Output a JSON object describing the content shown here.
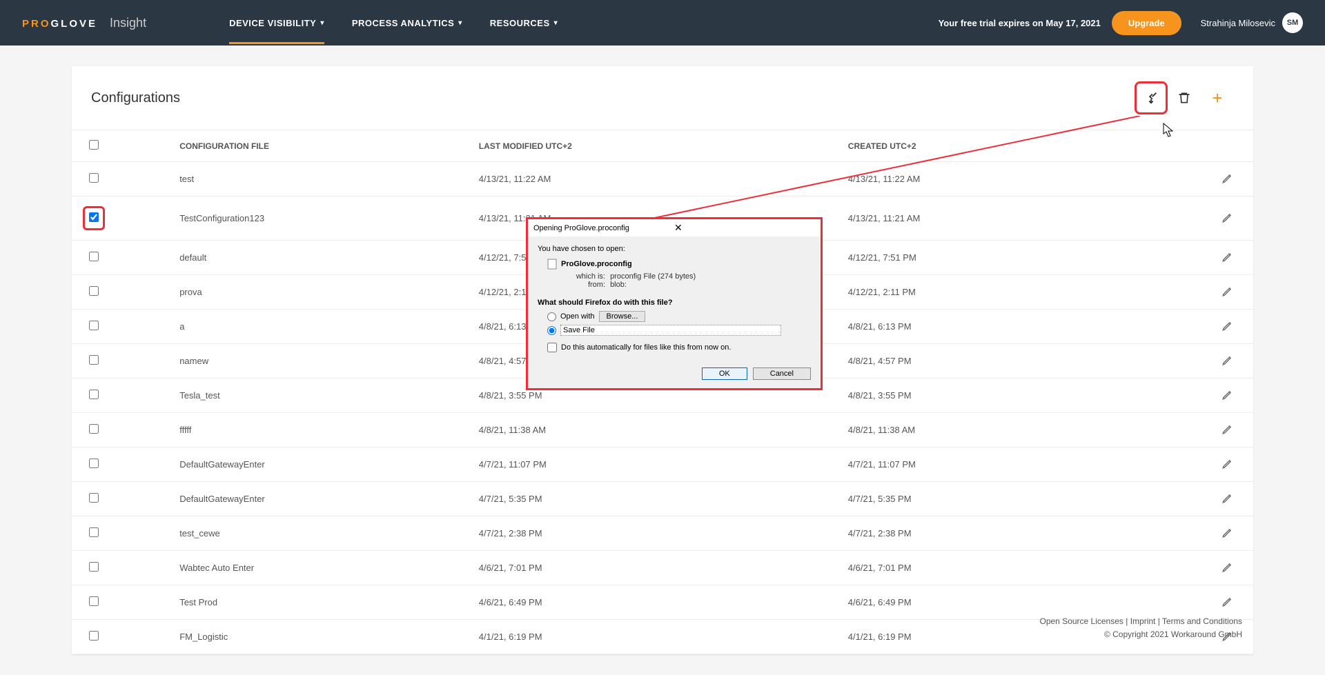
{
  "header": {
    "logo_pro": "PRO",
    "logo_glove": "GLOVE",
    "product": "Insight",
    "nav": [
      {
        "label": "DEVICE VISIBILITY",
        "active": true
      },
      {
        "label": "PROCESS ANALYTICS",
        "active": false
      },
      {
        "label": "RESOURCES",
        "active": false
      }
    ],
    "trial": "Your free trial expires on May 17, 2021",
    "upgrade": "Upgrade",
    "user_name": "Strahinja Milosevic",
    "user_initials": "SM"
  },
  "page": {
    "title": "Configurations",
    "columns": {
      "cfg": "CONFIGURATION FILE",
      "lm": "LAST MODIFIED UTC+2",
      "cr": "CREATED UTC+2"
    },
    "rows": [
      {
        "name": "test",
        "lm": "4/13/21, 11:22 AM",
        "cr": "4/13/21, 11:22 AM",
        "checked": false,
        "hl": false
      },
      {
        "name": "TestConfiguration123",
        "lm": "4/13/21, 11:21 AM",
        "cr": "4/13/21, 11:21 AM",
        "checked": true,
        "hl": true
      },
      {
        "name": "default",
        "lm": "4/12/21, 7:51 PM",
        "cr": "4/12/21, 7:51 PM",
        "checked": false,
        "hl": false
      },
      {
        "name": "prova",
        "lm": "4/12/21, 2:11 PM",
        "cr": "4/12/21, 2:11 PM",
        "checked": false,
        "hl": false
      },
      {
        "name": "a",
        "lm": "4/8/21, 6:13 PM",
        "cr": "4/8/21, 6:13 PM",
        "checked": false,
        "hl": false
      },
      {
        "name": "namew",
        "lm": "4/8/21, 4:57 PM",
        "cr": "4/8/21, 4:57 PM",
        "checked": false,
        "hl": false
      },
      {
        "name": "Tesla_test",
        "lm": "4/8/21, 3:55 PM",
        "cr": "4/8/21, 3:55 PM",
        "checked": false,
        "hl": false
      },
      {
        "name": "fffff",
        "lm": "4/8/21, 11:38 AM",
        "cr": "4/8/21, 11:38 AM",
        "checked": false,
        "hl": false
      },
      {
        "name": "DefaultGatewayEnter",
        "lm": "4/7/21, 11:07 PM",
        "cr": "4/7/21, 11:07 PM",
        "checked": false,
        "hl": false
      },
      {
        "name": "DefaultGatewayEnter",
        "lm": "4/7/21, 5:35 PM",
        "cr": "4/7/21, 5:35 PM",
        "checked": false,
        "hl": false
      },
      {
        "name": "test_cewe",
        "lm": "4/7/21, 2:38 PM",
        "cr": "4/7/21, 2:38 PM",
        "checked": false,
        "hl": false
      },
      {
        "name": "Wabtec Auto Enter",
        "lm": "4/6/21, 7:01 PM",
        "cr": "4/6/21, 7:01 PM",
        "checked": false,
        "hl": false
      },
      {
        "name": "Test Prod",
        "lm": "4/6/21, 6:49 PM",
        "cr": "4/6/21, 6:49 PM",
        "checked": false,
        "hl": false
      },
      {
        "name": "FM_Logistic",
        "lm": "4/1/21, 6:19 PM",
        "cr": "4/1/21, 6:19 PM",
        "checked": false,
        "hl": false
      }
    ]
  },
  "dialog": {
    "title": "Opening ProGlove.proconfig",
    "intro": "You have chosen to open:",
    "file": "ProGlove.proconfig",
    "whichis_lbl": "which is:",
    "whichis": "proconfig File (274 bytes)",
    "from_lbl": "from:",
    "from": "blob:",
    "question": "What should Firefox do with this file?",
    "openwith": "Open with",
    "browse": "Browse...",
    "savefile": "Save File",
    "auto": "Do this automatically for files like this from now on.",
    "ok": "OK",
    "cancel": "Cancel"
  },
  "footer": {
    "links": "Open Source Licenses | Imprint | Terms and Conditions",
    "copy": "© Copyright 2021 Workaround GmbH"
  }
}
